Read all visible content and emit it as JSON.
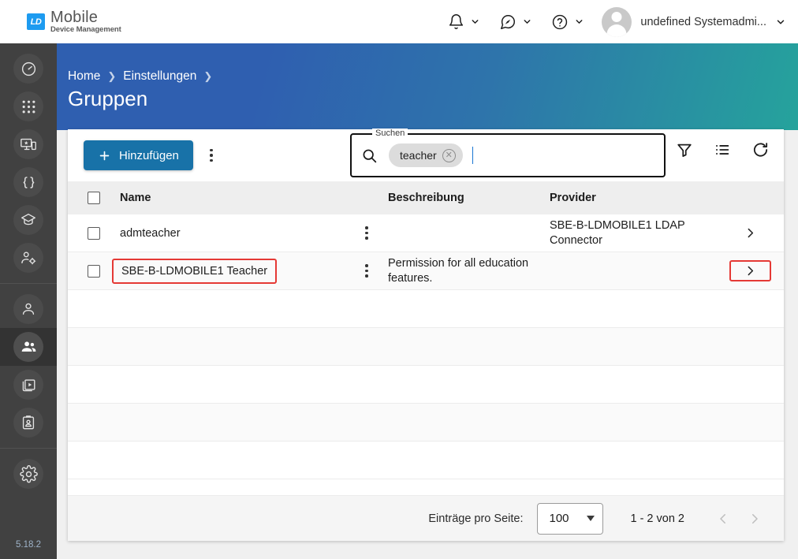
{
  "header": {
    "logo": {
      "mark": "LD",
      "title": "Mobile",
      "subtitle": "Device Management"
    },
    "icons": [
      {
        "name": "notifications-bell-icon",
        "label": "bell-icon"
      },
      {
        "name": "support-compass-icon",
        "label": "compass-chat-icon"
      },
      {
        "name": "help-question-icon",
        "label": "question-icon"
      }
    ],
    "user": {
      "name": "undefined Systemadmi...",
      "avatar": "user-avatar"
    }
  },
  "sidebar": {
    "version": "5.18.2",
    "groups": [
      {
        "items": [
          {
            "name": "dashboard",
            "icon": "gauge-icon"
          },
          {
            "name": "apps",
            "icon": "grid-icon"
          },
          {
            "name": "devices",
            "icon": "monitor-phone-icon"
          },
          {
            "name": "scripts",
            "icon": "braces-icon"
          },
          {
            "name": "education",
            "icon": "graduation-cap-icon"
          },
          {
            "name": "user-management",
            "icon": "user-gear-icon"
          }
        ]
      },
      {
        "items": [
          {
            "name": "users",
            "icon": "person-icon",
            "active": false
          },
          {
            "name": "groups",
            "icon": "people-icon",
            "active": true
          },
          {
            "name": "media",
            "icon": "media-library-icon",
            "active": false
          },
          {
            "name": "profiles",
            "icon": "id-badge-icon",
            "active": false
          }
        ]
      },
      {
        "items": [
          {
            "name": "settings",
            "icon": "gear-icon"
          }
        ]
      }
    ]
  },
  "banner": {
    "breadcrumb": [
      "Home",
      "Einstellungen"
    ],
    "separator": "›",
    "title": "Gruppen",
    "gradient_from": "#2f5fb0",
    "gradient_to": "#25a39c"
  },
  "toolbar": {
    "add_label": "Hinzufügen",
    "add_icon": "plus-icon",
    "add_color": "#1872a8",
    "overflow_icon": "vertical-dots-icon",
    "search": {
      "legend": "Suchen",
      "icon": "search-icon",
      "value": "",
      "placeholder": "",
      "chips": [
        {
          "label": "teacher",
          "remove_icon": "chip-remove-icon"
        }
      ]
    },
    "icons": [
      {
        "name": "filter-icon",
        "label": "Filter"
      },
      {
        "name": "columns-list-icon",
        "label": "Spalten"
      },
      {
        "name": "refresh-icon",
        "label": "Aktualisieren"
      }
    ]
  },
  "table": {
    "columns": [
      "Name",
      "Beschreibung",
      "Provider"
    ],
    "select_all_icon": "checkbox-unchecked",
    "rows": [
      {
        "selected": false,
        "name": "admteacher",
        "description": "",
        "provider": "SBE-B-LDMOBILE1 LDAP Connector",
        "row_menu_icon": "vertical-dots-icon",
        "detail_icon": "chevron-right-icon",
        "highlight_name": false,
        "highlight_arrow": false
      },
      {
        "selected": false,
        "name": "SBE-B-LDMOBILE1 Teacher",
        "description": "Permission for all education features.",
        "provider": "",
        "row_menu_icon": "vertical-dots-icon",
        "detail_icon": "chevron-right-icon",
        "highlight_name": true,
        "highlight_arrow": true
      }
    ],
    "empty_row_count": 5,
    "highlight_color": "#e53935"
  },
  "footer": {
    "per_page_label": "Einträge pro Seite:",
    "per_page_value": "100",
    "range_text": "1 - 2 von 2",
    "prev_icon": "chevron-left-icon",
    "next_icon": "chevron-right-icon"
  }
}
